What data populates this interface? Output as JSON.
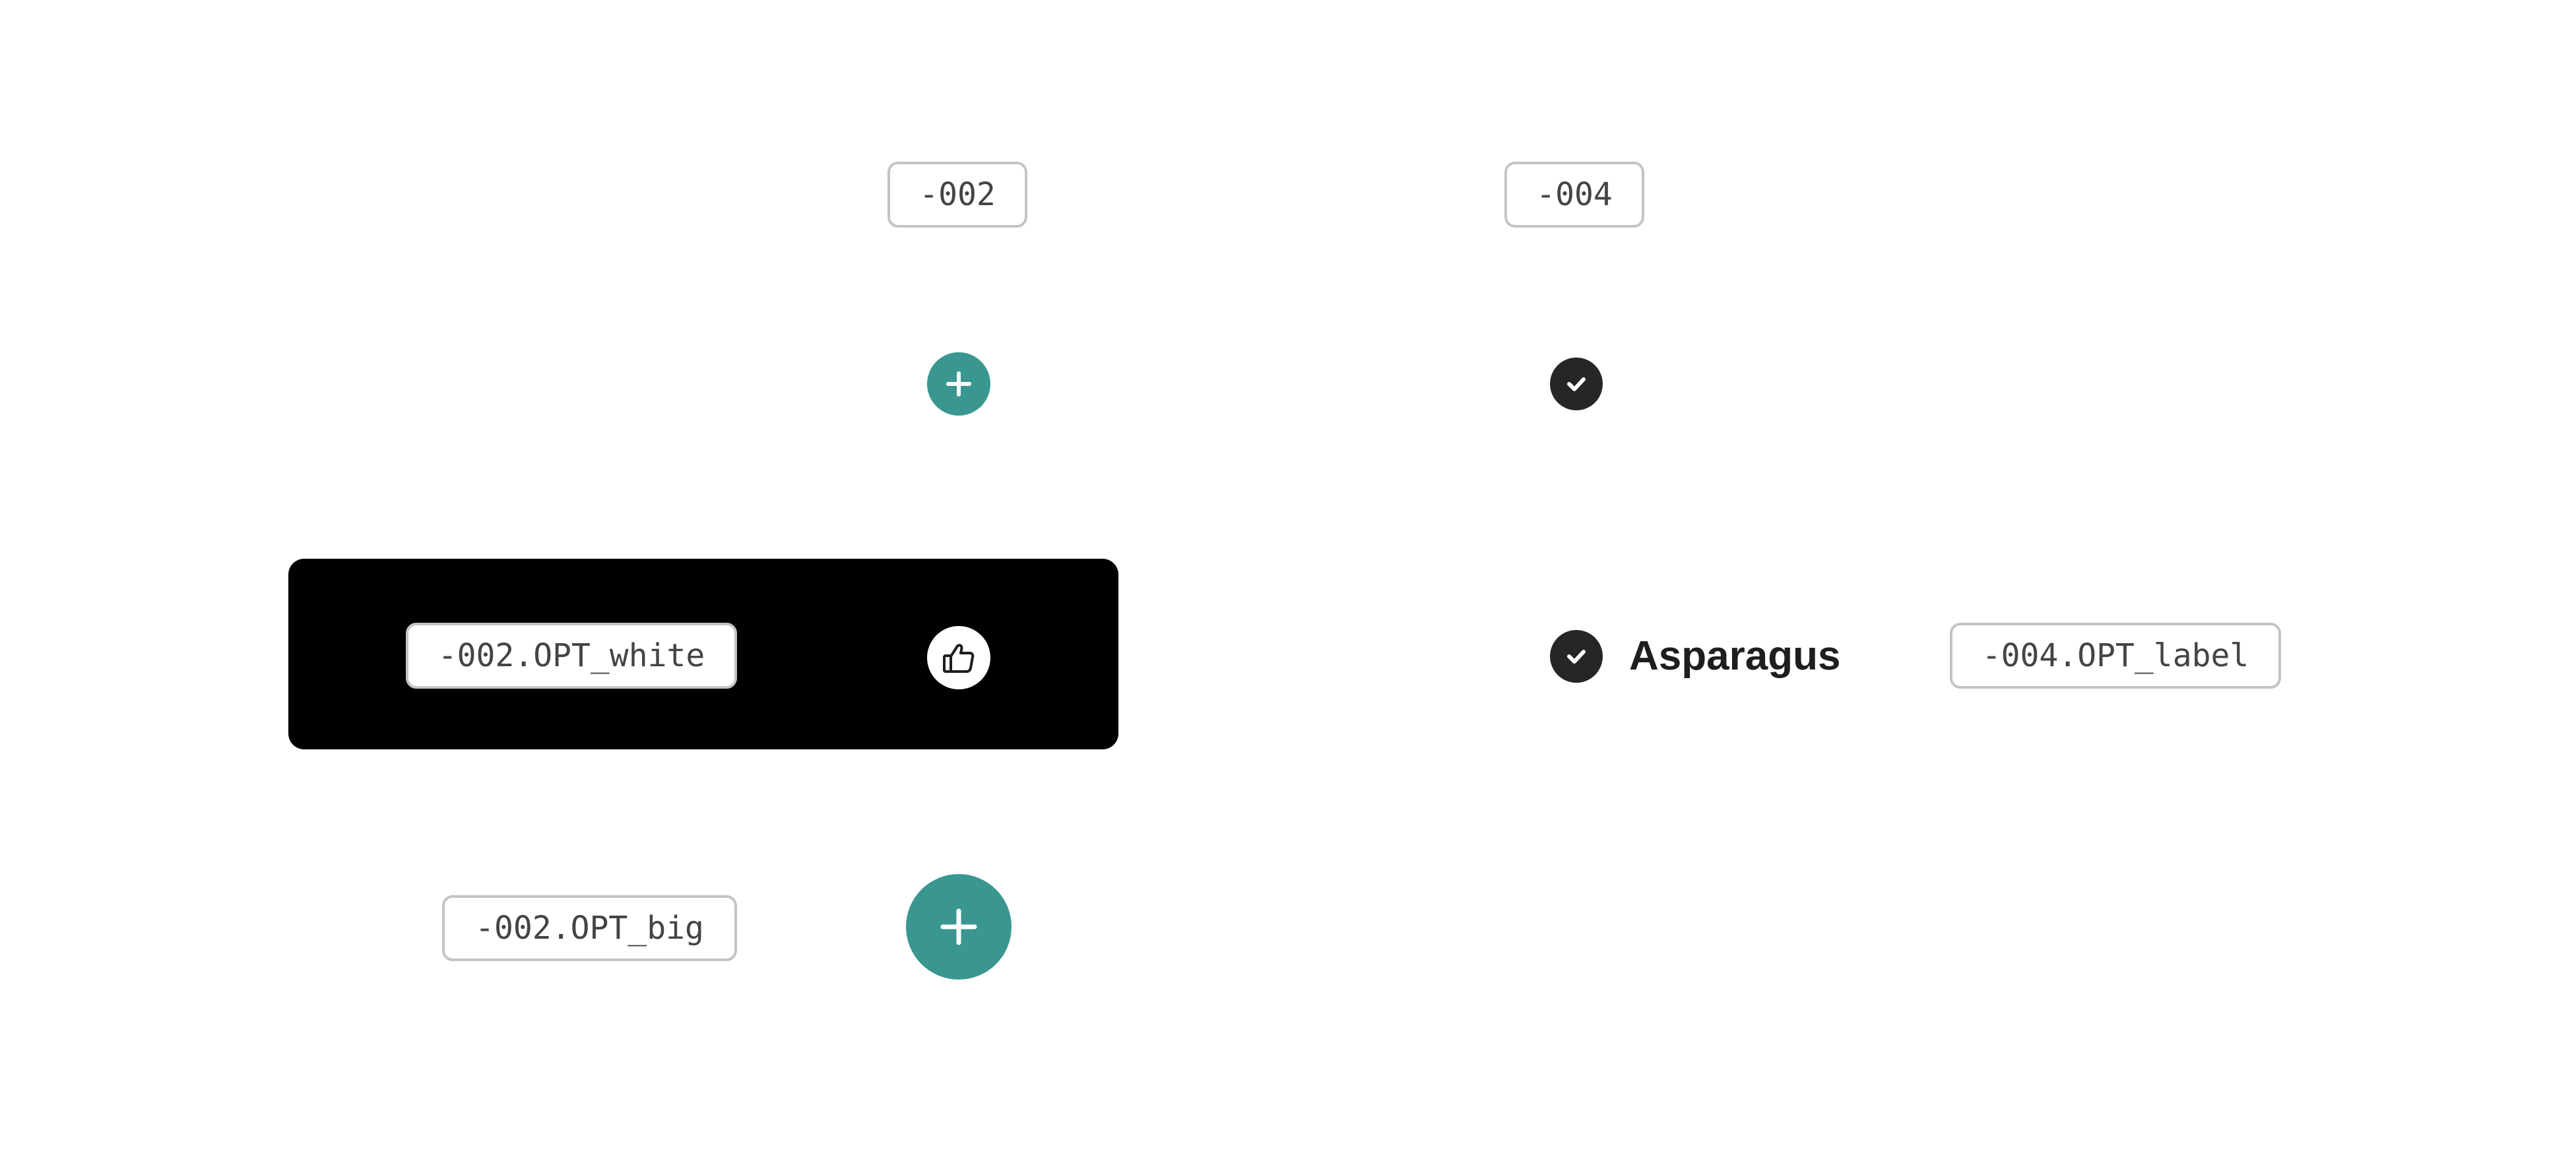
{
  "tags": {
    "variant_002": "-002",
    "variant_004": "-004",
    "variant_002_white": "-002.OPT_white",
    "variant_004_label": "-004.OPT_label",
    "variant_002_big": "-002.OPT_big"
  },
  "checkbox_item": {
    "label": "Asparagus"
  },
  "icons": {
    "plus": "plus-icon",
    "check": "check-icon",
    "thumbs_up": "thumbs-up-icon"
  },
  "colors": {
    "teal_accent": "#3a9790",
    "dark_badge": "#262626",
    "panel_background": "#000000",
    "tag_border": "#c4c4c4"
  }
}
